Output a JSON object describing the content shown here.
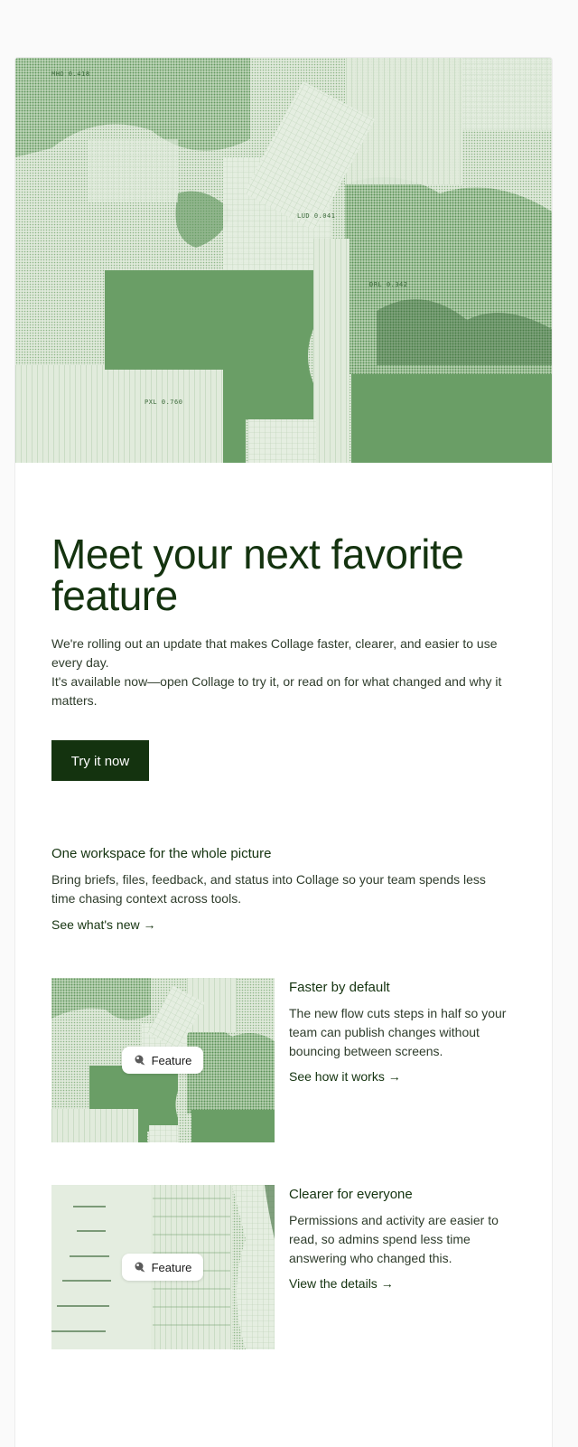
{
  "hero": {
    "labels": [
      "MHO 0.418",
      "LUD 0.041",
      "DRL 0.342",
      "PXL 0.760"
    ],
    "colors": {
      "light": "#dfe9da",
      "mid": "#a9c8a2",
      "dark": "#6a9e66",
      "deep": "#3c6a3b"
    }
  },
  "headline": "Meet your next favorite feature",
  "intro": {
    "line1": "We're rolling out an update that makes Collage faster, clearer, and easier to use every day.",
    "line2": "It's available now—open Collage to try it, or read on for what changed and why it matters."
  },
  "cta_label": "Try it now",
  "workspace": {
    "title": "One workspace for the whole picture",
    "description": "Bring briefs, files, feedback, and status into Collage so your team spends less time chasing context across tools.",
    "link": "See what's new →"
  },
  "features": [
    {
      "title": "Faster by default",
      "description": "The new flow cuts steps in half so your team can publish changes without bouncing between screens.",
      "link": "See how it works →",
      "badge": "Feature",
      "badge_icon": "feature-sparkle-icon"
    },
    {
      "title": "Clearer for everyone",
      "description": "Permissions and activity are easier to read, so admins spend less time answering who changed this.",
      "link": "View the details →",
      "badge": "Feature",
      "badge_icon": "feature-sparkle-icon"
    }
  ],
  "colors": {
    "brand_dark": "#14330f",
    "text": "#2f3d2c",
    "page_bg": "#fafafa"
  }
}
